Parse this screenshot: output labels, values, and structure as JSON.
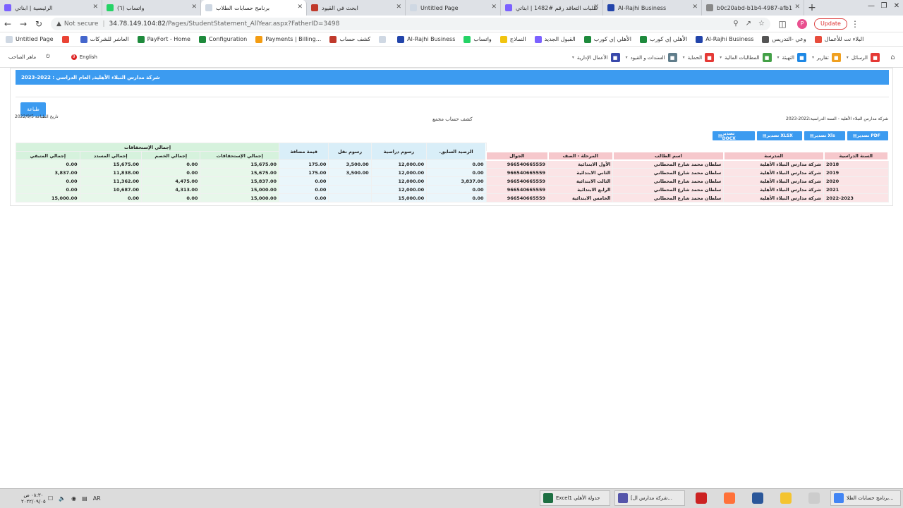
{
  "browser": {
    "tabs": [
      {
        "title": "الرئيسية | ابناتي",
        "color": "#7b61ff"
      },
      {
        "title": "(٦) واتساب",
        "color": "#25d366"
      },
      {
        "title": "برنامج حسابات الطلاب",
        "color": "#cfd8e3"
      },
      {
        "title": "ابحث في القيود",
        "color": "#c0392b"
      },
      {
        "title": "Untitled Page",
        "color": "#cfd8e3"
      },
      {
        "title": "طلبات التعاقد رقم #1482 | ابناتي",
        "color": "#7b61ff"
      },
      {
        "title": "Al-Rajhi Business",
        "color": "#2244aa"
      },
      {
        "title": "b0c20abd-b1b4-4987-afb1",
        "color": "#888888"
      }
    ],
    "url_warning": "Not secure",
    "url_host": "34.78.149.104:82",
    "url_path": "/Pages/StudentStatement_AllYear.aspx?FatherID=3498",
    "profile_initial": "P",
    "update_label": "Update",
    "bookmarks": [
      {
        "label": "Untitled Page",
        "color": "#cfd8e3"
      },
      {
        "label": "",
        "color": "#ea4335"
      },
      {
        "label": "العاشر للشركات",
        "color": "#4466cc"
      },
      {
        "label": "PayFort - Home",
        "color": "#1e8a3c"
      },
      {
        "label": "Configuration",
        "color": "#1e8a3c"
      },
      {
        "label": "Payments | Billing...",
        "color": "#f39c12"
      },
      {
        "label": "كشف حساب",
        "color": "#c0392b"
      },
      {
        "label": "",
        "color": "#cfd8e3"
      },
      {
        "label": "Al-Rajhi Business",
        "color": "#2244aa"
      },
      {
        "label": "واتساب",
        "color": "#25d366"
      },
      {
        "label": "النماذج",
        "color": "#f1c40f"
      },
      {
        "label": "القبول الجديد",
        "color": "#7b61ff"
      },
      {
        "label": "الأهلي إي كورب",
        "color": "#1e8a3c"
      },
      {
        "label": "الأهلي إي كورب",
        "color": "#1e8a3c"
      },
      {
        "label": "Al-Rajhi Business",
        "color": "#2244aa"
      },
      {
        "label": "وعي -التدريس",
        "color": "#555555"
      },
      {
        "label": "البلاء نت للأعمال",
        "color": "#e74c3c"
      }
    ]
  },
  "app": {
    "user_name": "ماهر الصاحب",
    "notif_count": "9",
    "language": "English",
    "menu": [
      {
        "label": "",
        "color": "#666666",
        "caret": false
      },
      {
        "label": "الرسائل",
        "color": "#e53935",
        "caret": true
      },
      {
        "label": "تقارير",
        "color": "#f0a020",
        "caret": true
      },
      {
        "label": "التهيئة",
        "color": "#1e88e5",
        "caret": true
      },
      {
        "label": "المطالبات المالية",
        "color": "#43a047",
        "caret": true
      },
      {
        "label": "الحماية",
        "color": "#e53935",
        "caret": true
      },
      {
        "label": "السندات و القيود",
        "color": "#607d8b",
        "caret": true
      },
      {
        "label": "الأعمال الإدارية",
        "color": "#3949ab",
        "caret": true
      }
    ]
  },
  "report": {
    "header": "شركة مدارس النبلاء الأهلية, العام الدراسي : 2022-2023",
    "print_label": "طباعة",
    "print_date": "تاريخ الطباعة 2022/9/5",
    "title": "كشف حساب مجمع",
    "school_line": "شركة مدارس النبلاء الأهلية - السنة الدراسية:2022-2023",
    "exports": [
      "تصدير PDF",
      "تصدير Xls",
      "تصدير XLSX",
      "تصدير DOCX"
    ],
    "group_header": "إجمالي الإستحقاقات",
    "columns": [
      "السنة الدراسية",
      "المدرسة",
      "اسم الطالب",
      "المرحلة - الصف",
      "الجوال",
      "الرصيد السابق.",
      "رسوم دراسية",
      "رسوم نقل",
      "قيمة مضافة",
      "إجمالي الإستحقاقات",
      "إجمالي الخصم",
      "إجمالي المسدد",
      "إجمالي المتبقي"
    ],
    "rows": [
      [
        "2018",
        "شركة مدارس النبلاء الأهلية",
        "سلطان محمد شارع المحطاني",
        "الأول الابتدائية",
        "966540665559",
        "0.00",
        "12,000.00",
        "3,500.00",
        "175.00",
        "15,675.00",
        "0.00",
        "15,675.00",
        "0.00"
      ],
      [
        "2019",
        "شركة مدارس النبلاء الأهلية",
        "سلطان محمد شارع المحطاني",
        "الثاني الابتدائية",
        "966540665559",
        "0.00",
        "12,000.00",
        "3,500.00",
        "175.00",
        "15,675.00",
        "0.00",
        "11,838.00",
        "3,837.00"
      ],
      [
        "2020",
        "شركة مدارس النبلاء الأهلية",
        "سلطان محمد شارع المحطاني",
        "الثالث الابتدائية",
        "966540665559",
        "3,837.00",
        "12,000.00",
        "",
        "0.00",
        "15,837.00",
        "4,475.00",
        "11,362.00",
        "0.00"
      ],
      [
        "2021",
        "شركة مدارس النبلاء الأهلية",
        "سلطان محمد شارع المحطاني",
        "الرابع الابتدائية",
        "966540665559",
        "0.00",
        "12,000.00",
        "",
        "0.00",
        "15,000.00",
        "4,313.00",
        "10,687.00",
        "0.00"
      ],
      [
        "2022-2023",
        "شركة مدارس النبلاء الأهلية",
        "سلطان محمد شارع المحطاني",
        "الخامس الابتدائية",
        "966540665559",
        "0.00",
        "15,000.00",
        "",
        "0.00",
        "15,000.00",
        "0.00",
        "0.00",
        "15,000.00"
      ]
    ]
  },
  "taskbar": {
    "time": "٠٨:٣٠ ص",
    "date": "٢٠٢٢/٠٩/٠٥",
    "lang": "AR",
    "windows": [
      {
        "label": "برنامج حسابات الطلا...",
        "color": "#4285f4"
      },
      {
        "label": "",
        "color": "#cccccc"
      },
      {
        "label": "",
        "color": "#f4c430"
      },
      {
        "label": "",
        "color": "#2b579a"
      },
      {
        "label": "",
        "color": "#ff7139"
      },
      {
        "label": "",
        "color": "#cc2222"
      },
      {
        "label": "[شركة مدارس ال...",
        "color": "#5555aa"
      },
      {
        "label": "Excel1 جدولة الأهلي",
        "color": "#1d6f42"
      }
    ]
  }
}
